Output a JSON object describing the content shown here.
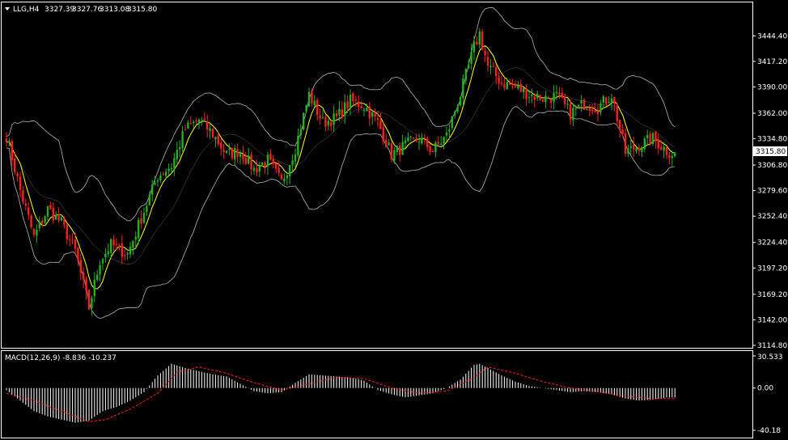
{
  "chart_data": [
    {
      "type": "candlestick",
      "header": {
        "symbol": "LLG,H4",
        "open": "3327.39",
        "high": "3327.76",
        "low": "3313.08",
        "close": "3315.80"
      },
      "price_axis": {
        "ticks": [
          "3444.40",
          "3417.20",
          "3390.00",
          "3362.00",
          "3334.80",
          "3306.80",
          "3279.60",
          "3252.40",
          "3224.40",
          "3197.20",
          "3169.20",
          "3142.00",
          "3114.80"
        ],
        "ylim": [
          3114.8,
          3455.0
        ],
        "current_price_label": "3315.80"
      },
      "indicators": [
        "Bollinger Bands",
        "Moving Average"
      ],
      "colors": {
        "bull": "#21b021",
        "bear": "#ff1e1e",
        "bands": "#b4b4b4",
        "ma": "#ffff00",
        "background": "#000000"
      },
      "anchors": [
        [
          0,
          3338
        ],
        [
          5,
          3280
        ],
        [
          10,
          3230
        ],
        [
          15,
          3260
        ],
        [
          20,
          3245
        ],
        [
          25,
          3215
        ],
        [
          30,
          3155
        ],
        [
          34,
          3205
        ],
        [
          38,
          3222
        ],
        [
          44,
          3212
        ],
        [
          50,
          3258
        ],
        [
          55,
          3295
        ],
        [
          60,
          3306
        ],
        [
          65,
          3345
        ],
        [
          70,
          3355
        ],
        [
          75,
          3340
        ],
        [
          80,
          3318
        ],
        [
          85,
          3322
        ],
        [
          90,
          3302
        ],
        [
          95,
          3312
        ],
        [
          100,
          3288
        ],
        [
          105,
          3325
        ],
        [
          110,
          3382
        ],
        [
          115,
          3352
        ],
        [
          120,
          3357
        ],
        [
          125,
          3375
        ],
        [
          130,
          3370
        ],
        [
          135,
          3352
        ],
        [
          140,
          3318
        ],
        [
          145,
          3328
        ],
        [
          150,
          3335
        ],
        [
          155,
          3322
        ],
        [
          160,
          3338
        ],
        [
          165,
          3382
        ],
        [
          170,
          3432
        ],
        [
          172,
          3447
        ],
        [
          175,
          3412
        ],
        [
          180,
          3395
        ],
        [
          185,
          3390
        ],
        [
          190,
          3382
        ],
        [
          195,
          3378
        ],
        [
          200,
          3380
        ],
        [
          205,
          3362
        ],
        [
          210,
          3372
        ],
        [
          215,
          3368
        ],
        [
          220,
          3382
        ],
        [
          225,
          3320
        ],
        [
          230,
          3328
        ],
        [
          235,
          3335
        ],
        [
          240,
          3322
        ],
        [
          243,
          3318
        ]
      ]
    },
    {
      "type": "histogram",
      "title": "MACD(12,26,9) -8.836 -10.237",
      "axis_ticks": [
        "30.533",
        "0.00",
        "-40.18"
      ],
      "ylim": [
        -40.18,
        30.533
      ],
      "hist_anchors": [
        [
          0,
          -2
        ],
        [
          5,
          -12
        ],
        [
          10,
          -22
        ],
        [
          15,
          -27
        ],
        [
          20,
          -30
        ],
        [
          25,
          -33
        ],
        [
          30,
          -31
        ],
        [
          35,
          -22
        ],
        [
          40,
          -18
        ],
        [
          45,
          -12
        ],
        [
          50,
          -4
        ],
        [
          55,
          12
        ],
        [
          60,
          23
        ],
        [
          65,
          19
        ],
        [
          70,
          16
        ],
        [
          75,
          13
        ],
        [
          80,
          11
        ],
        [
          85,
          4
        ],
        [
          90,
          -3
        ],
        [
          95,
          -5
        ],
        [
          100,
          -4
        ],
        [
          105,
          5
        ],
        [
          110,
          13
        ],
        [
          115,
          12
        ],
        [
          120,
          11
        ],
        [
          125,
          10
        ],
        [
          130,
          7
        ],
        [
          135,
          -2
        ],
        [
          140,
          -6
        ],
        [
          145,
          -9
        ],
        [
          150,
          -7
        ],
        [
          155,
          -5
        ],
        [
          160,
          0
        ],
        [
          165,
          8
        ],
        [
          170,
          22
        ],
        [
          172,
          23
        ],
        [
          175,
          19
        ],
        [
          180,
          12
        ],
        [
          185,
          6
        ],
        [
          190,
          2
        ],
        [
          195,
          0
        ],
        [
          200,
          -2
        ],
        [
          205,
          -4
        ],
        [
          210,
          -3
        ],
        [
          215,
          -4
        ],
        [
          220,
          -6
        ],
        [
          225,
          -10
        ],
        [
          230,
          -12
        ],
        [
          235,
          -11
        ],
        [
          240,
          -9
        ],
        [
          243,
          -9
        ]
      ],
      "signal_anchors": [
        [
          0,
          -5
        ],
        [
          10,
          -12
        ],
        [
          20,
          -22
        ],
        [
          30,
          -32
        ],
        [
          36,
          -30
        ],
        [
          45,
          -20
        ],
        [
          55,
          -5
        ],
        [
          62,
          15
        ],
        [
          70,
          20
        ],
        [
          80,
          14
        ],
        [
          90,
          5
        ],
        [
          100,
          -2
        ],
        [
          110,
          4
        ],
        [
          120,
          10
        ],
        [
          130,
          9
        ],
        [
          140,
          0
        ],
        [
          150,
          -5
        ],
        [
          160,
          -3
        ],
        [
          170,
          10
        ],
        [
          175,
          20
        ],
        [
          185,
          14
        ],
        [
          195,
          6
        ],
        [
          205,
          0
        ],
        [
          215,
          -3
        ],
        [
          225,
          -8
        ],
        [
          235,
          -10
        ],
        [
          243,
          -10
        ]
      ],
      "colors": {
        "hist": "#ffffff",
        "signal": "#ff1e1e"
      }
    }
  ]
}
